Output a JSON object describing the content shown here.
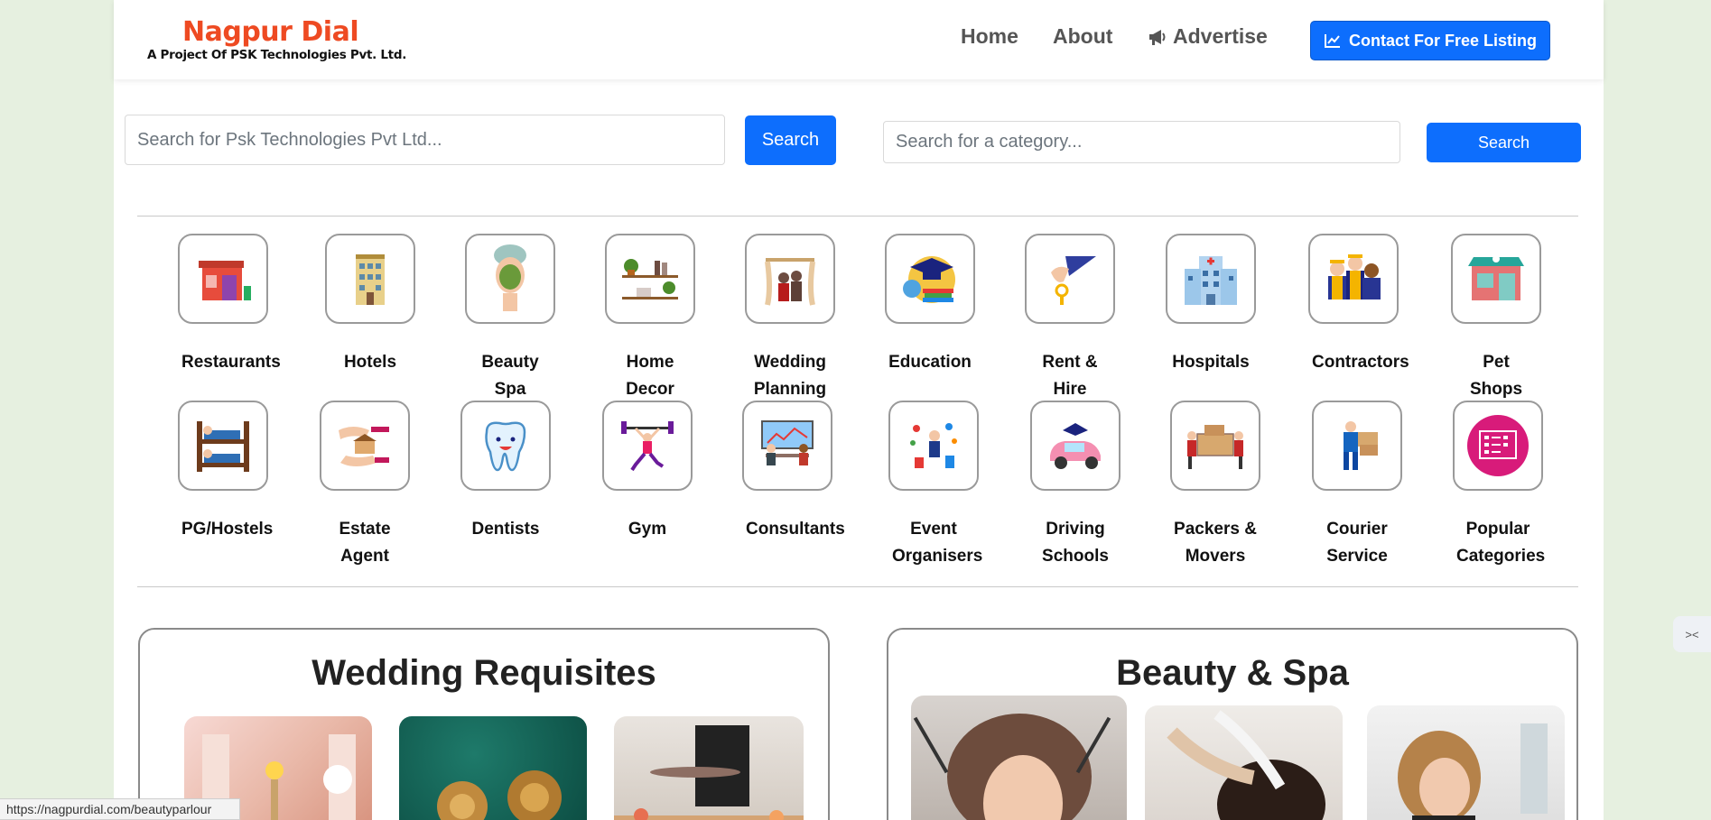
{
  "header": {
    "logo_title": "Nagpur Dial",
    "logo_subtitle": "A Project Of PSK Technologies Pvt. Ltd.",
    "nav": {
      "home": "Home",
      "about": "About",
      "advertise": "Advertise"
    },
    "cta_label": "Contact For Free Listing",
    "brand_color": "#ee4a22",
    "accent_color": "#0d6efd"
  },
  "search": {
    "business_placeholder": "Search for Psk Technologies Pvt Ltd...",
    "business_button": "Search",
    "category_placeholder": "Search for a category...",
    "category_button": "Search"
  },
  "categories": [
    {
      "label": "Restaurants",
      "icon": "restaurant-icon"
    },
    {
      "label": "Hotels",
      "icon": "hotel-icon"
    },
    {
      "label": "Beauty Spa",
      "icon": "beauty-spa-icon"
    },
    {
      "label": "Home Decor",
      "icon": "home-decor-icon"
    },
    {
      "label": "Wedding Planning",
      "icon": "wedding-icon"
    },
    {
      "label": "Education",
      "icon": "education-icon"
    },
    {
      "label": "Rent & Hire",
      "icon": "rent-key-icon"
    },
    {
      "label": "Hospitals",
      "icon": "hospital-icon"
    },
    {
      "label": "Contractors",
      "icon": "contractors-icon"
    },
    {
      "label": "Pet Shops",
      "icon": "pet-shop-icon"
    },
    {
      "label": "PG/Hostels",
      "icon": "bunk-bed-icon"
    },
    {
      "label": "Estate Agent",
      "icon": "estate-agent-icon"
    },
    {
      "label": "Dentists",
      "icon": "tooth-icon"
    },
    {
      "label": "Gym",
      "icon": "gym-icon"
    },
    {
      "label": "Consultants",
      "icon": "consultants-icon"
    },
    {
      "label": "Event Organisers",
      "icon": "event-icon"
    },
    {
      "label": "Driving Schools",
      "icon": "driving-car-icon"
    },
    {
      "label": "Packers & Movers",
      "icon": "packers-icon"
    },
    {
      "label": "Courier Service",
      "icon": "courier-icon"
    },
    {
      "label": "Popular Categories",
      "icon": "popular-categories-icon"
    }
  ],
  "sections": {
    "left_title": "Wedding Requisites",
    "right_title": "Beauty & Spa"
  },
  "status_bar": {
    "url": "https://nagpurdial.com/beautyparlour"
  },
  "side_widget": {
    "icon": "collapse-icon"
  }
}
